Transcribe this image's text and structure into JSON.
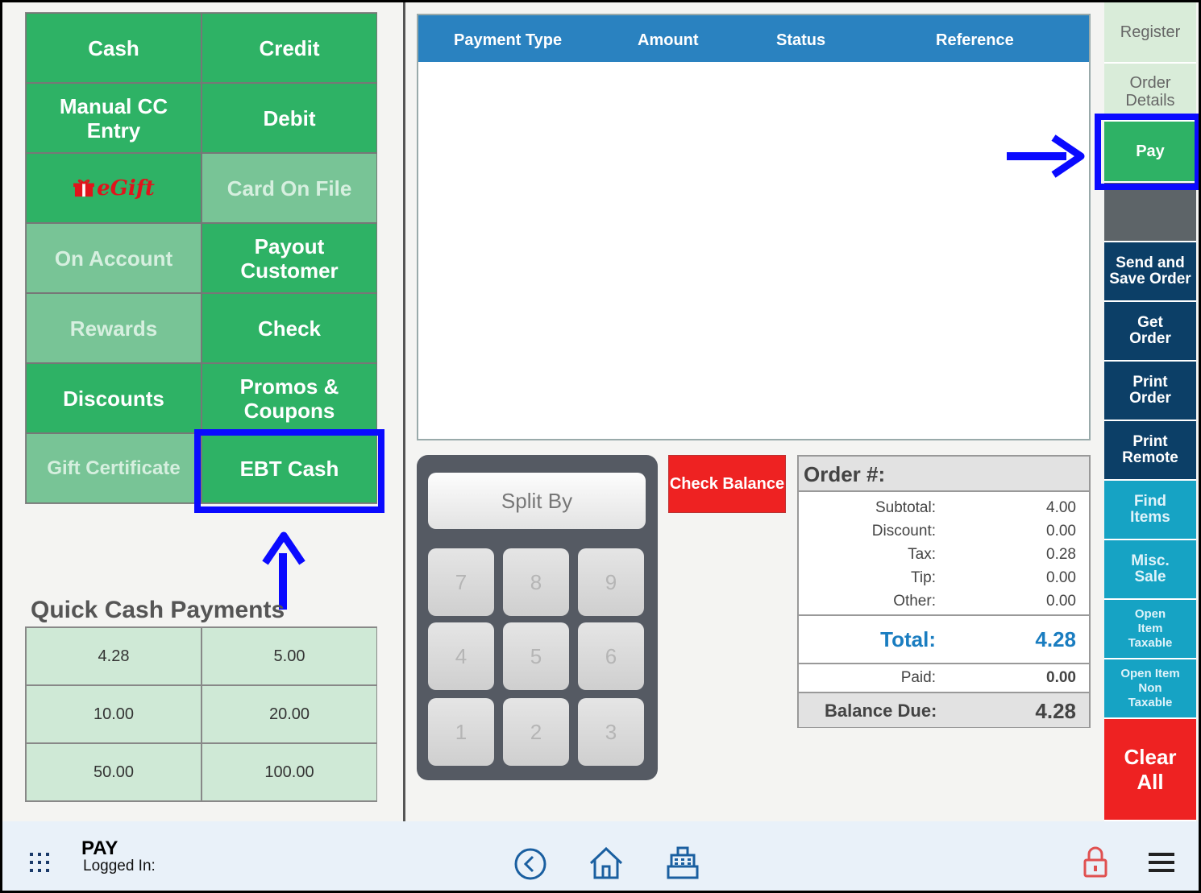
{
  "payment_buttons": [
    {
      "label": "Cash",
      "enabled": true
    },
    {
      "label": "Credit",
      "enabled": true
    },
    {
      "label": "Manual CC Entry",
      "enabled": true
    },
    {
      "label": "Debit",
      "enabled": true
    },
    {
      "label": "eGift",
      "enabled": true
    },
    {
      "label": "Card On File",
      "enabled": false
    },
    {
      "label": "On Account",
      "enabled": false
    },
    {
      "label": "Payout Customer",
      "enabled": true
    },
    {
      "label": "Rewards",
      "enabled": false
    },
    {
      "label": "Check",
      "enabled": true
    },
    {
      "label": "Discounts",
      "enabled": true
    },
    {
      "label": "Promos & Coupons",
      "enabled": true
    },
    {
      "label": "Gift Certificate",
      "enabled": false
    },
    {
      "label": "EBT Cash",
      "enabled": true
    }
  ],
  "quick_cash": {
    "title": "Quick Cash Payments",
    "amounts": [
      "4.28",
      "5.00",
      "10.00",
      "20.00",
      "50.00",
      "100.00"
    ]
  },
  "payment_table": {
    "columns": [
      "Payment Type",
      "Amount",
      "Status",
      "Reference"
    ]
  },
  "keypad": {
    "split_label": "Split By",
    "keys": [
      "7",
      "8",
      "9",
      "4",
      "5",
      "6",
      "1",
      "2",
      "3"
    ]
  },
  "check_balance": "Check Balance",
  "order": {
    "title": "Order #:",
    "subtotal_label": "Subtotal:",
    "subtotal": "4.00",
    "discount_label": "Discount:",
    "discount": "0.00",
    "tax_label": "Tax:",
    "tax": "0.28",
    "tip_label": "Tip:",
    "tip": "0.00",
    "other_label": "Other:",
    "other": "0.00",
    "total_label": "Total:",
    "total": "4.28",
    "paid_label": "Paid:",
    "paid": "0.00",
    "balance_label": "Balance Due:",
    "balance": "4.28"
  },
  "sidebar": {
    "register": "Register",
    "order_details": "Order Details",
    "pay": "Pay",
    "send_save": "Send and Save Order",
    "get_order": "Get Order",
    "print_order": "Print Order",
    "print_remote": "Print Remote",
    "find_items": "Find Items",
    "misc_sale": "Misc. Sale",
    "open_taxable": "Open Item Taxable",
    "open_non_taxable": "Open Item Non Taxable",
    "clear_all": "Clear All"
  },
  "bottom": {
    "title": "PAY",
    "logged_in": "Logged In:"
  },
  "colors": {
    "green": "#2eb265",
    "green_disabled": "#78c496",
    "blue_header": "#2a82c0",
    "navy": "#0c3f67",
    "teal": "#16a3c4",
    "red": "#ee2222",
    "highlight": "#0a0aff"
  }
}
